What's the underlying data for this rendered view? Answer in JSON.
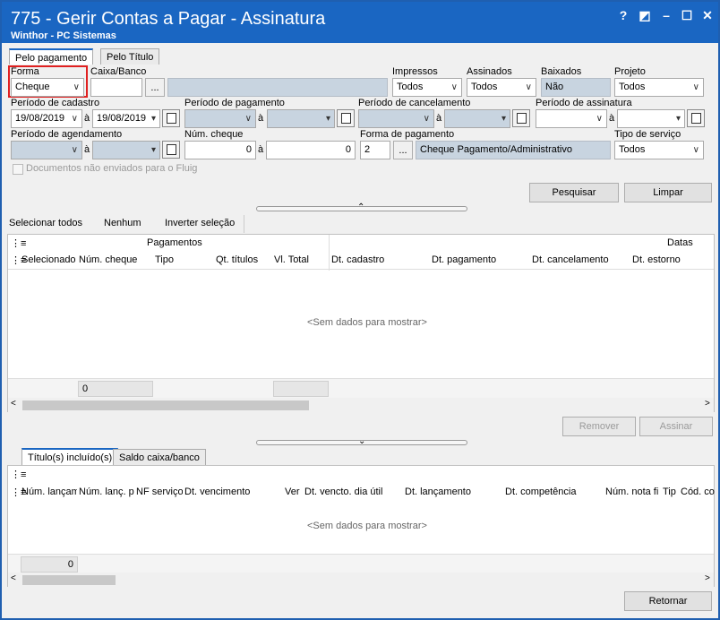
{
  "window": {
    "title": "775 - Gerir Contas a Pagar - Assinatura",
    "subtitle": "Winthor - PC Sistemas",
    "help": "?",
    "restore": "◩",
    "minimize": "–",
    "maximize": "☐",
    "close": "✕"
  },
  "top_tabs": [
    {
      "label": "Pelo pagamento"
    },
    {
      "label": "Pelo Título"
    }
  ],
  "filters": {
    "forma_label": "Forma",
    "forma_value": "Cheque",
    "caixa_label": "Caixa/Banco",
    "caixa_btn": "...",
    "impressos_label": "Impressos",
    "impressos_value": "Todos",
    "assinados_label": "Assinados",
    "assinados_value": "Todos",
    "baixados_label": "Baixados",
    "baixados_value": "Não",
    "projeto_label": "Projeto",
    "projeto_value": "Todos",
    "cadastro_label": "Período de cadastro",
    "cadastro_from": "19/08/2019",
    "cadastro_to": "19/08/2019",
    "a": "à",
    "pagamento_label": "Período de pagamento",
    "cancelamento_label": "Período de cancelamento",
    "assinatura_label": "Período de assinatura",
    "agendamento_label": "Período de agendamento",
    "num_cheque_label": "Núm. cheque",
    "num_cheque_from": "0",
    "num_cheque_to": "0",
    "forma_pagto_label": "Forma de pagamento",
    "forma_pagto_code": "2",
    "forma_pagto_btn": "...",
    "forma_pagto_desc": "Cheque Pagamento/Administrativo",
    "tipo_servico_label": "Tipo de serviço",
    "tipo_servico_value": "Todos",
    "fluig_label": "Documentos não enviados para o Fluig"
  },
  "actions": {
    "pesquisar": "Pesquisar",
    "limpar": "Limpar",
    "selecionar_todos": "Selecionar todos",
    "nenhum": "Nenhum",
    "inverter": "Inverter seleção",
    "remover": "Remover",
    "assinar": "Assinar",
    "retornar": "Retornar"
  },
  "grid1": {
    "group_pagamentos": "Pagamentos",
    "group_datas": "Datas",
    "columns": [
      "Selecionado",
      "Núm. cheque",
      "Tipo",
      "Qt. títulos",
      "Vl. Total",
      "Dt. cadastro",
      "Dt. pagamento",
      "Dt. cancelamento",
      "Dt. estorno"
    ],
    "empty": "<Sem dados para mostrar>",
    "footer_value": "0"
  },
  "bottom_tabs": [
    {
      "label": "Título(s) incluído(s)"
    },
    {
      "label": "Saldo caixa/banco"
    }
  ],
  "grid2": {
    "columns": [
      "Núm. lançam",
      "Núm. lanç. p",
      "NF serviço",
      "Dt. vencimento",
      "Ver",
      "Dt. vencto. dia útil",
      "Dt. lançamento",
      "Dt. competência",
      "Núm. nota fi",
      "Tip",
      "Cód. co"
    ],
    "empty": "<Sem dados para mostrar>",
    "footer_value": "0"
  },
  "colors": {
    "titlebar": "#1a66c2",
    "highlight": "#e02020"
  }
}
